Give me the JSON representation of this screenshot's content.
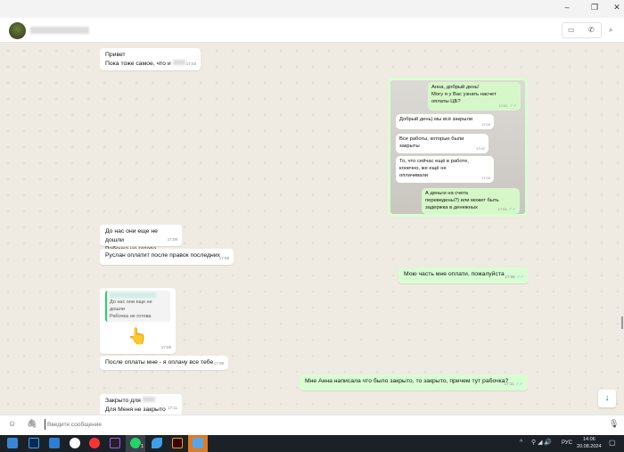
{
  "window": {
    "minimize": "–",
    "maximize": "❐",
    "close": "✕"
  },
  "header": {
    "video_icon": "video-icon",
    "call_icon": "phone-icon",
    "search_icon": "search-icon"
  },
  "messages": [
    {
      "dir": "in",
      "lines": [
        "Привет",
        "Пока тоже самое, что и"
      ],
      "time": "17:03"
    },
    {
      "dir": "in",
      "lines": [
        "До нас они еще не дошли",
        "Рабочка не готова"
      ],
      "time": "17:08"
    },
    {
      "dir": "in",
      "lines": [
        "Руслан оплатит после правок последних"
      ],
      "time": "17:08"
    },
    {
      "dir": "out",
      "lines": [
        "Мою часть мне оплати, пожалуйста"
      ],
      "time": "17:09"
    },
    {
      "dir": "in",
      "quote": [
        "До нас они еще не дошли",
        "Рабочка не готова"
      ],
      "emoji": "👆",
      "time": "17:09"
    },
    {
      "dir": "in",
      "lines": [
        "После оплаты мне - я оплачу все тебе"
      ],
      "time": "17:09"
    },
    {
      "dir": "out",
      "lines": [
        "Мне Анна написала что было закрыто, то закрыто, причем тут рабочка?"
      ],
      "time": "17:11"
    },
    {
      "dir": "in",
      "lines": [
        "Закрыто для",
        "Для Меня не закрыто"
      ],
      "time": "17:11"
    }
  ],
  "screenshot": {
    "m1": {
      "lines": [
        "Анна, добрый день!",
        "Могу я у Вас узнать насчет",
        "оплаты ЦБ?"
      ],
      "time": "17:01"
    },
    "m2": {
      "lines": [
        "Добрый день) мы всё закрыли"
      ],
      "time": "17:02"
    },
    "m3": {
      "lines": [
        "Все работы, которые были",
        "закрыты"
      ],
      "time": "17:02"
    },
    "m4": {
      "lines": [
        "То, что сейчас ещё в работе,",
        "конечно,  же ещё не",
        "оплачивали"
      ],
      "time": "17:02"
    },
    "m5": {
      "lines": [
        "А деньги на счета",
        "переведены?) или может быть",
        "задержка в денежных"
      ],
      "time": "17:04"
    }
  },
  "input": {
    "placeholder": "Введите сообщение"
  },
  "taskbar": {
    "lang": "РУС",
    "time": "14:06",
    "date": "20.08.2024",
    "badge": "1"
  }
}
